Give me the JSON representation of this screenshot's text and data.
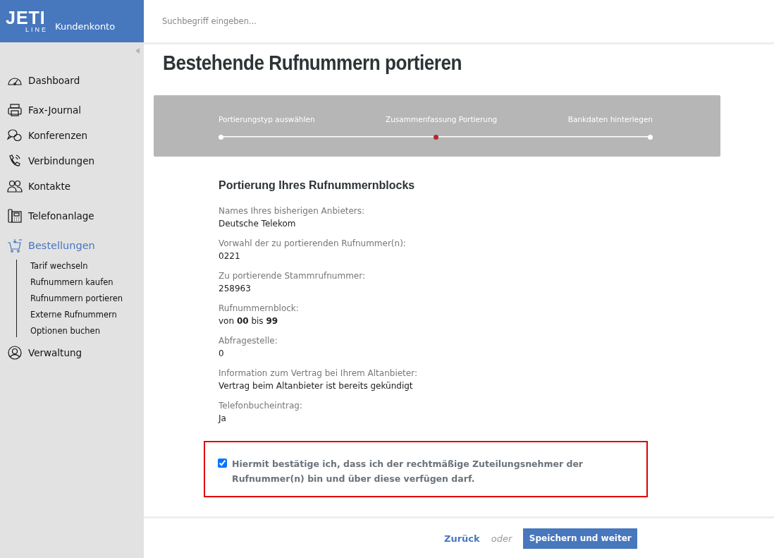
{
  "logo": {
    "top": "JETI",
    "bottom": "LINE",
    "subtitle": "Kundenkonto"
  },
  "search": {
    "placeholder": "Suchbegriff eingeben..."
  },
  "sidebar": {
    "groups": [
      [
        {
          "label": "Dashboard",
          "selected": false
        }
      ],
      [
        {
          "label": "Fax-Journal",
          "selected": false
        },
        {
          "label": "Konferenzen",
          "selected": false
        },
        {
          "label": "Verbindungen",
          "selected": false
        },
        {
          "label": "Kontakte",
          "selected": false
        }
      ],
      [
        {
          "label": "Telefonanlage",
          "selected": false
        }
      ],
      [
        {
          "label": "Bestellungen",
          "selected": true,
          "children": [
            {
              "label": "Tarif wechseln"
            },
            {
              "label": "Rufnummern kaufen"
            },
            {
              "label": "Rufnummern portieren"
            },
            {
              "label": "Externe Rufnummern"
            },
            {
              "label": "Optionen buchen"
            }
          ]
        },
        {
          "label": "Verwaltung",
          "selected": false
        }
      ]
    ]
  },
  "page_title": "Bestehende Rufnummern portieren",
  "steps": [
    {
      "label": "Portierungstyp auswählen",
      "selected": false
    },
    {
      "label": "Zusammenfassung Portierung",
      "selected": true
    },
    {
      "label": "Bankdaten hinterlegen",
      "selected": false
    }
  ],
  "section_title": "Portierung Ihres Rufnummernblocks",
  "fields": [
    {
      "label": "Names Ihres bisherigen Anbieters:",
      "value": "Deutsche Telekom"
    },
    {
      "label": "Vorwahl der zu portierenden Rufnummer(n):",
      "value": "0221"
    },
    {
      "label": "Zu portierende Stammrufnummer:",
      "value": "258963"
    },
    {
      "label": "Rufnummernblock:",
      "value": "von **00** bis **99**"
    },
    {
      "label": "Abfragestelle:",
      "value": "0"
    },
    {
      "label": "Information zum Vertrag bei Ihrem Altanbieter:",
      "value": "Vertrag beim Altanbieter ist bereits gekündigt"
    },
    {
      "label": "Telefonbucheintrag:",
      "value": "Ja"
    }
  ],
  "confirmation": {
    "checked": true,
    "text": "Hiermit bestätige ich, dass ich der rechtmäßige Zuteilungsnehmer der Rufnummer(n) bin und über diese verfügen darf."
  },
  "footer": {
    "back": "Zurück",
    "or": "oder",
    "submit": "Speichern und weiter"
  }
}
